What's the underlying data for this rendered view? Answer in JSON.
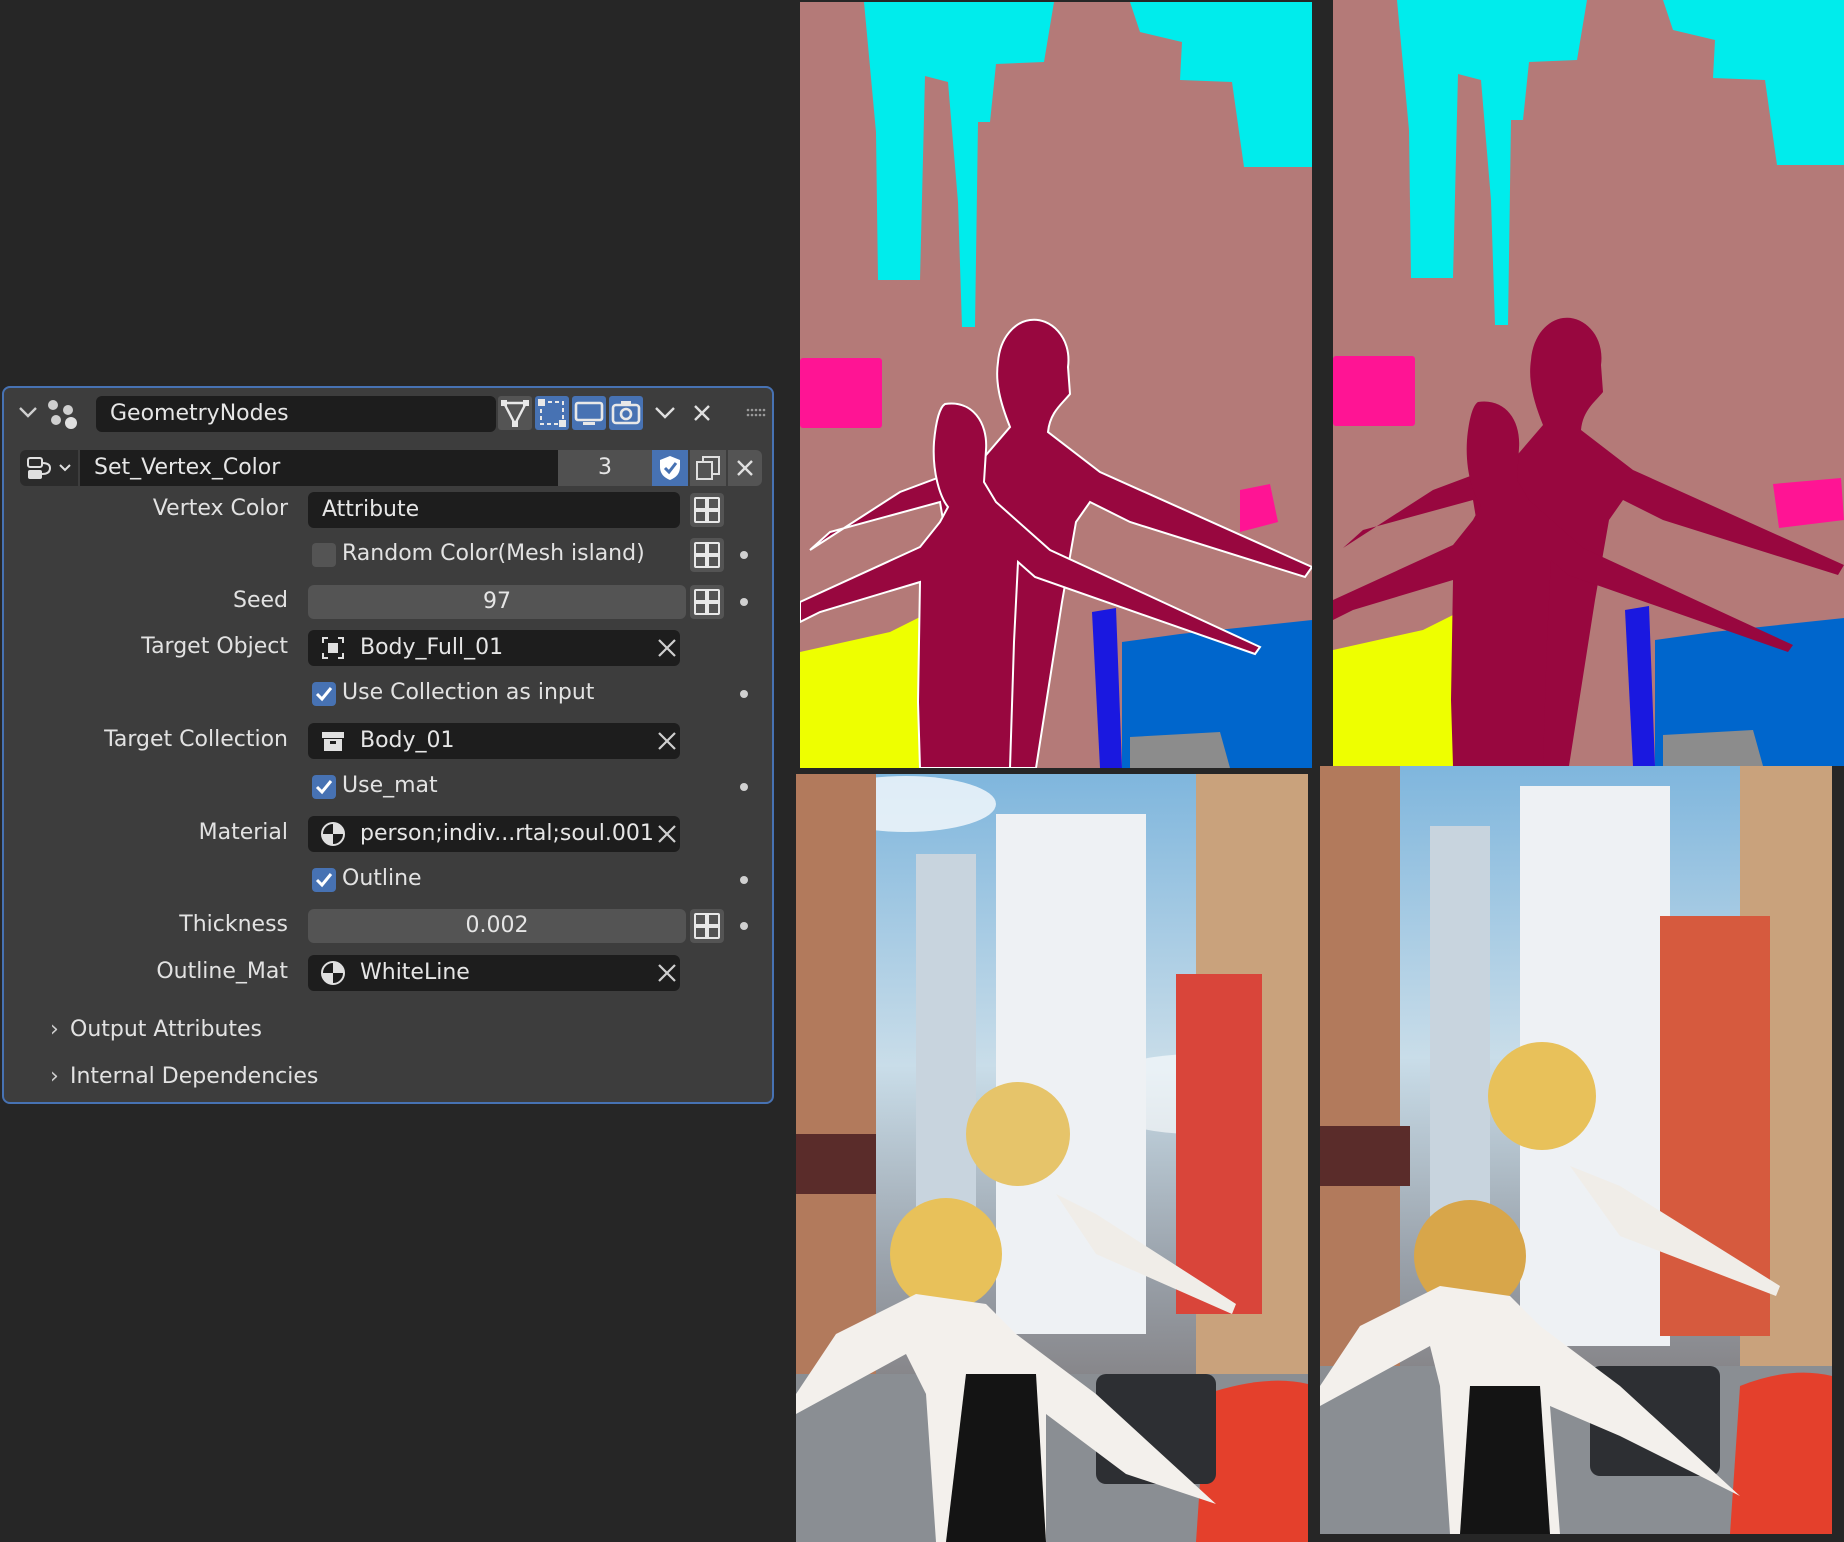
{
  "modifier": {
    "name": "GeometryNodes",
    "node_group": "Set_Vertex_Color",
    "users": "3"
  },
  "fields": {
    "vertex_color": {
      "label": "Vertex Color",
      "value": "Attribute"
    },
    "random_color": {
      "label": "Random Color(Mesh island)",
      "checked": false
    },
    "seed": {
      "label": "Seed",
      "value": "97"
    },
    "target_object": {
      "label": "Target Object",
      "value": "Body_Full_01"
    },
    "use_collection": {
      "label": "Use Collection as input",
      "checked": true
    },
    "target_collection": {
      "label": "Target Collection",
      "value": "Body_01"
    },
    "use_mat": {
      "label": "Use_mat",
      "checked": true
    },
    "material": {
      "label": "Material",
      "value": "person;indiv...rtal;soul.001"
    },
    "outline": {
      "label": "Outline",
      "checked": true
    },
    "thickness": {
      "label": "Thickness",
      "value": "0.002"
    },
    "outline_mat": {
      "label": "Outline_Mat",
      "value": "WhiteLine"
    }
  },
  "sections": [
    {
      "label": "Output Attributes"
    },
    {
      "label": "Internal Dependencies"
    }
  ],
  "icons": {
    "collapse": "chevron-down-icon",
    "modifier": "geometry-nodes-icon",
    "edit_mode": "edit-mode-icon",
    "cage": "cage-icon",
    "viewport": "monitor-icon",
    "render": "camera-icon",
    "dropdown": "chevron-down-icon",
    "remove": "close-icon",
    "drag": "drag-handle-icon",
    "browse": "node-tree-icon",
    "fake_user": "shield-icon",
    "duplicate": "copy-icon",
    "unlink": "close-icon"
  },
  "colors": {
    "accent": "#4772b3",
    "panel_bg": "#3d3d3d",
    "field_bg": "#1d1d1d",
    "seg_background": "#b47a78",
    "seg_person": "#98073f",
    "seg_cyan": "#00ecec",
    "seg_pink": "#ff1494",
    "seg_yellow": "#eeff00",
    "seg_blue": "#0066cc"
  }
}
